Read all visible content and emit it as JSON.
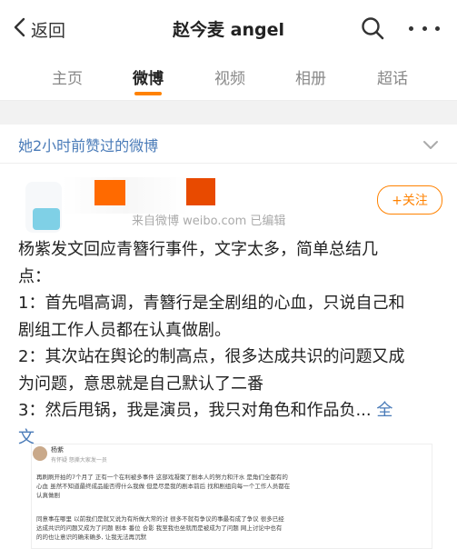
{
  "header": {
    "back_label": "返回",
    "title": "赵今麦 angel"
  },
  "tabs": [
    "主页",
    "微博",
    "视频",
    "相册",
    "超话"
  ],
  "active_tab": "微博",
  "liked_section": {
    "label": "她2小时前赞过的微博"
  },
  "post": {
    "source": "来自微博 weibo.com  已编辑",
    "follow_label": "+关注",
    "text_lines": [
      "杨紫发文回应青簪行事件，文字太多，简单总结几",
      "点：",
      "1：首先唱高调，青簪行是全剧组的心血，只说自己和",
      "剧组工作人员都在认真做剧。",
      "2：其次站在舆论的制高点，很多达成共识的问题又成",
      "为问题，意思就是自己默认了二番",
      "3：然后甩锅，我是演员，我只对角色和作品负..."
    ],
    "full_text_label": "全",
    "last_line": "文"
  },
  "embedded_screenshot": {
    "name": "杨紫",
    "subtitle": "有怀疑 怒撕大家发一员",
    "lines": [
      "再刷刷开拍的7个月了 正有一个在利被多事件 这部戏凝聚了剧本人的努力和汗水 是角们全都有的",
      "心血 虽然不知道最终成品能否得什么我做 但是尽是我的剧本前后 找和剧组向每一个工作人员都在",
      "认真做剧",
      "",
      "同意事在哪里 以前我们是就又说为有所做大常的讨 很多不就有争议的事最有成了争议 很多已经",
      "达成共识的问题又成为了问题 剧本 番位 合影 我至我也坐就而是被成为了问题 网上讨论中也有",
      "的的也让意识的确未确多, 让我无法再沉默"
    ]
  },
  "colors": {
    "accent": "#ff8200",
    "link": "#4a7bb8"
  }
}
